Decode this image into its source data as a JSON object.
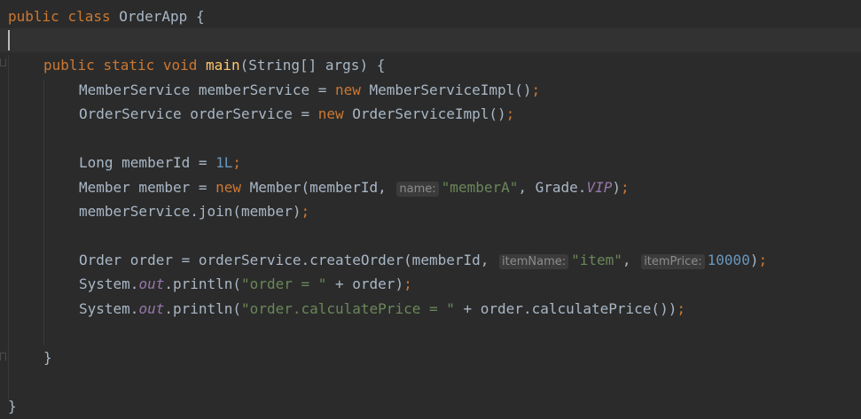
{
  "editor": {
    "lines": [
      {
        "id": "l1",
        "tokens": [
          "public",
          " ",
          "class",
          " OrderApp {"
        ]
      },
      {
        "id": "l3",
        "tokens": [
          "public",
          " ",
          "static",
          " ",
          "void",
          " ",
          "main",
          "(String[] args) {"
        ]
      },
      {
        "id": "l4",
        "tokens": [
          "MemberService memberService = ",
          "new",
          " MemberServiceImpl()",
          ";"
        ]
      },
      {
        "id": "l5",
        "tokens": [
          "OrderService orderService = ",
          "new",
          " OrderServiceImpl()",
          ";"
        ]
      },
      {
        "id": "l7",
        "tokens": [
          "Long memberId = ",
          "1L",
          ";"
        ]
      },
      {
        "id": "l8",
        "tokens": [
          "Member member = ",
          "new",
          " Member(memberId, ",
          "name:",
          "\"memberA\"",
          ", Grade.",
          "VIP",
          ")",
          ";"
        ]
      },
      {
        "id": "l9",
        "tokens": [
          "memberService.join(member)",
          ";"
        ]
      },
      {
        "id": "l11",
        "tokens": [
          "Order order = orderService.createOrder(memberId, ",
          "itemName:",
          "\"item\"",
          ", ",
          "itemPrice:",
          "10000",
          ")",
          ";"
        ]
      },
      {
        "id": "l12",
        "tokens": [
          "System.",
          "out",
          ".println(",
          "\"order = \"",
          " + order)",
          ";"
        ]
      },
      {
        "id": "l13",
        "tokens": [
          "System.",
          "out",
          ".println(",
          "\"order.calculatePrice = \"",
          " + order.calculatePrice())",
          ";"
        ]
      },
      {
        "id": "l15",
        "tokens": [
          "}"
        ]
      },
      {
        "id": "l17",
        "tokens": [
          "}"
        ]
      }
    ]
  },
  "colors": {
    "background": "#2b2b2b",
    "keyword": "#cc7832",
    "method_decl": "#ffc66d",
    "string": "#6a8759",
    "number": "#6897bb",
    "static_field": "#9876aa",
    "default_text": "#a9b7c6"
  }
}
